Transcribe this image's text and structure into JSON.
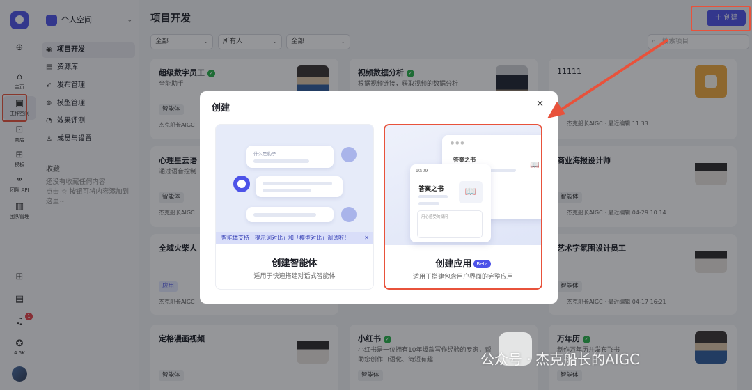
{
  "rail": {
    "items": [
      {
        "label": ""
      },
      {
        "label": "主页"
      },
      {
        "label": "工作空间"
      },
      {
        "label": "商店"
      },
      {
        "label": "模板"
      },
      {
        "label": "团队 API"
      },
      {
        "label": "团队管理"
      }
    ],
    "bottom": {
      "notification_count": "1",
      "stars": "4.5K"
    }
  },
  "sidebar": {
    "space_name": "个人空间",
    "nav": [
      {
        "label": "项目开发"
      },
      {
        "label": "资源库"
      },
      {
        "label": "发布管理"
      },
      {
        "label": "模型管理"
      },
      {
        "label": "效果评测"
      },
      {
        "label": "成员与设置"
      }
    ],
    "favorites_title": "收藏",
    "favorites_empty": "还没有收藏任何内容\n点击 ☆ 按钮可将内容添加到这里~"
  },
  "header": {
    "title": "项目开发",
    "create_label": "＋ 创建",
    "filters": [
      "全部",
      "所有人",
      "全部"
    ],
    "search_placeholder": "搜索项目"
  },
  "cards": [
    {
      "title": "超级数字员工",
      "verified": true,
      "desc": "全能助手",
      "tag": "智能体",
      "meta": "杰克船长AIGC"
    },
    {
      "title": "视频数据分析",
      "verified": true,
      "desc": "根据视频链接，获取视频的数据分析",
      "tag": "",
      "meta": ""
    },
    {
      "title": "11111",
      "verified": false,
      "desc": "",
      "tag": "",
      "meta": "杰克船长AIGC · 最近编辑 11:33"
    },
    {
      "title": "心理星云语",
      "verified": false,
      "desc": "通过语音控制",
      "tag": "智能体",
      "meta": "杰克船长AIGC"
    },
    {
      "title": "商业海报设计师",
      "verified": false,
      "desc": "",
      "tag": "智能体",
      "meta": "杰克船长AIGC · 最近编辑 04-29 10:14"
    },
    {
      "title": "全域火柴人",
      "verified": false,
      "desc": "",
      "tag": "应用",
      "meta": "杰克船长AIGC"
    },
    {
      "title": "艺术字氛围设计员工",
      "verified": false,
      "desc": "",
      "tag": "智能体",
      "meta": "杰克船长AIGC · 最近编辑 04-17 16:21"
    },
    {
      "title": "定格漫画视频",
      "verified": false,
      "desc": "",
      "tag": "智能体",
      "meta": ""
    },
    {
      "title": "小红书",
      "verified": true,
      "desc": "小红书是一位拥有10年爆款写作经验的专家，帮助您创作口语化、简短有趣",
      "tag": "智能体",
      "meta": ""
    },
    {
      "title": "万年历",
      "verified": true,
      "desc": "制作万年历并发布飞书",
      "tag": "智能体",
      "meta": ""
    }
  ],
  "modal": {
    "title": "创建",
    "options": [
      {
        "name": "创建智能体",
        "desc": "适用于快速搭建对话式智能体",
        "preview_question": "什么是豹子",
        "tip": "智能体支持「提示词对比」和「模型对比」调试啦！"
      },
      {
        "name": "创建应用",
        "badge": "Beta",
        "desc": "适用于搭建包含用户界面的完整应用",
        "preview_title": "答案之书",
        "preview_time": "10:09",
        "preview_input": "用心感受的疑问"
      }
    ]
  },
  "watermark": "公众号 · 杰克船长的AIGC"
}
